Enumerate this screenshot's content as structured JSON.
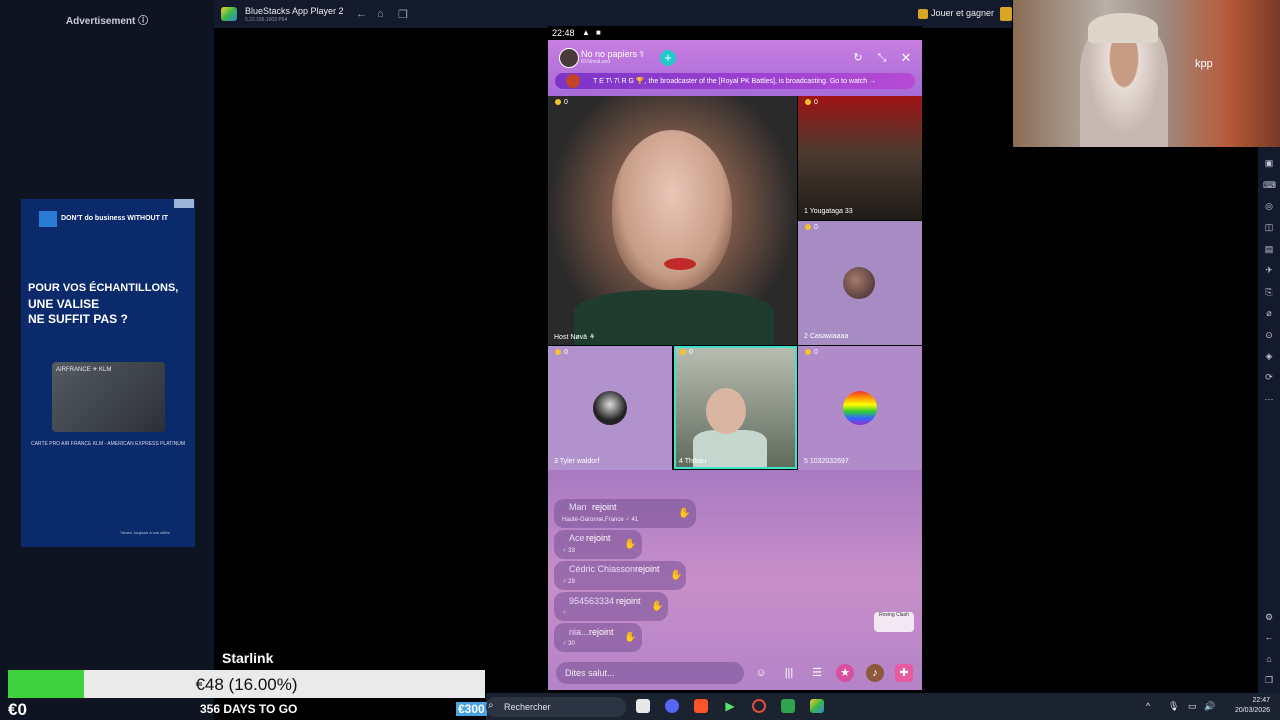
{
  "ad": {
    "label": "Advertisement ⓘ",
    "brand": "DON'T do business WITHOUT IT",
    "headline1": "POUR VOS ÉCHANTILLONS,",
    "headline2": "UNE VALISE",
    "headline3": "NE SUFFIT PAS ?",
    "card_brand": "AIRFRANCE ✈ KLM",
    "caption": "CARTE PRO AIR FRANCE KLM - AMERICAN EXPRESS PLATINUM",
    "footnote": "*Amex, toujours à vos côtés"
  },
  "bluestacks": {
    "title": "BlueStacks App Player 2",
    "version": "5.22.156.1003 P64",
    "play_label": "Jouer et gagner"
  },
  "phone": {
    "clock": "22:48",
    "room_name": "No no papiers ⚕",
    "room_id": "ID:NovaLand",
    "banner": "T E T\\ 7\\ R G 🏆, the broadcaster of the [Royal PK Battles], is broadcasting. Go to watch →",
    "tiles": [
      {
        "coins": "0",
        "name": "Host  Nøvä ⚘"
      },
      {
        "coins": "0",
        "name": "1  Yougataga 33"
      },
      {
        "coins": "0",
        "name": "2  Casawiaaaa"
      },
      {
        "coins": "0",
        "name": "3  Tyler waldorf"
      },
      {
        "coins": "0",
        "name": "4  Thibau"
      },
      {
        "coins": "0",
        "name": "5  1032032697"
      }
    ],
    "chat": [
      {
        "name": "Man",
        "action": "rejoint",
        "sub": "Haute-Garonne,France  ♂ 41"
      },
      {
        "name": "Ace",
        "action": "rejoint",
        "sub": "♂ 33"
      },
      {
        "name": "Cédric Chiasson",
        "action": "rejoint",
        "sub": "♂ 29"
      },
      {
        "name": "954563334",
        "action": "rejoint",
        "sub": "♂"
      },
      {
        "name": "nia...",
        "action": "rejoint",
        "sub": "♂ 30"
      }
    ],
    "input_placeholder": "Dites salut...",
    "roving": "Roving Clash"
  },
  "webcam": {
    "shirt_text": "kpp"
  },
  "overlay": {
    "starlink": "Starlink",
    "progress_text": "€48 (16.00%)",
    "progress_fraction": 0.16,
    "euro_zero": "€0",
    "days_to_go": "356 DAYS TO GO",
    "euro_target": "€300"
  },
  "taskbar": {
    "search": "Rechercher",
    "time": "22:47",
    "date": "20/03/2026"
  },
  "colors": {
    "accent_teal": "#42e0c8",
    "progress_green": "#3fd23f",
    "bs_bar": "#131a2b"
  }
}
